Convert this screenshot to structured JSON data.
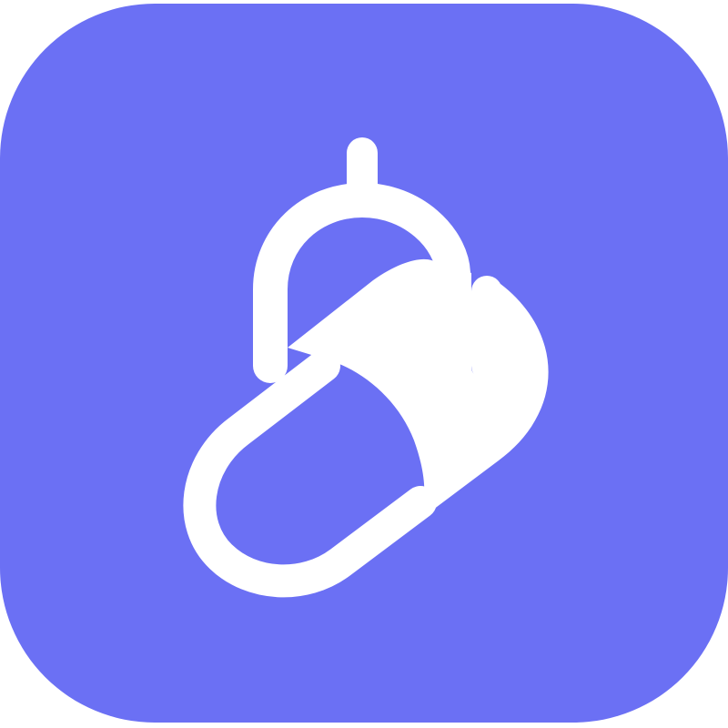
{
  "icon": {
    "name": "pill-tag-icon",
    "background_color": "#6B70F4",
    "glyph_color": "#FFFFFF"
  }
}
